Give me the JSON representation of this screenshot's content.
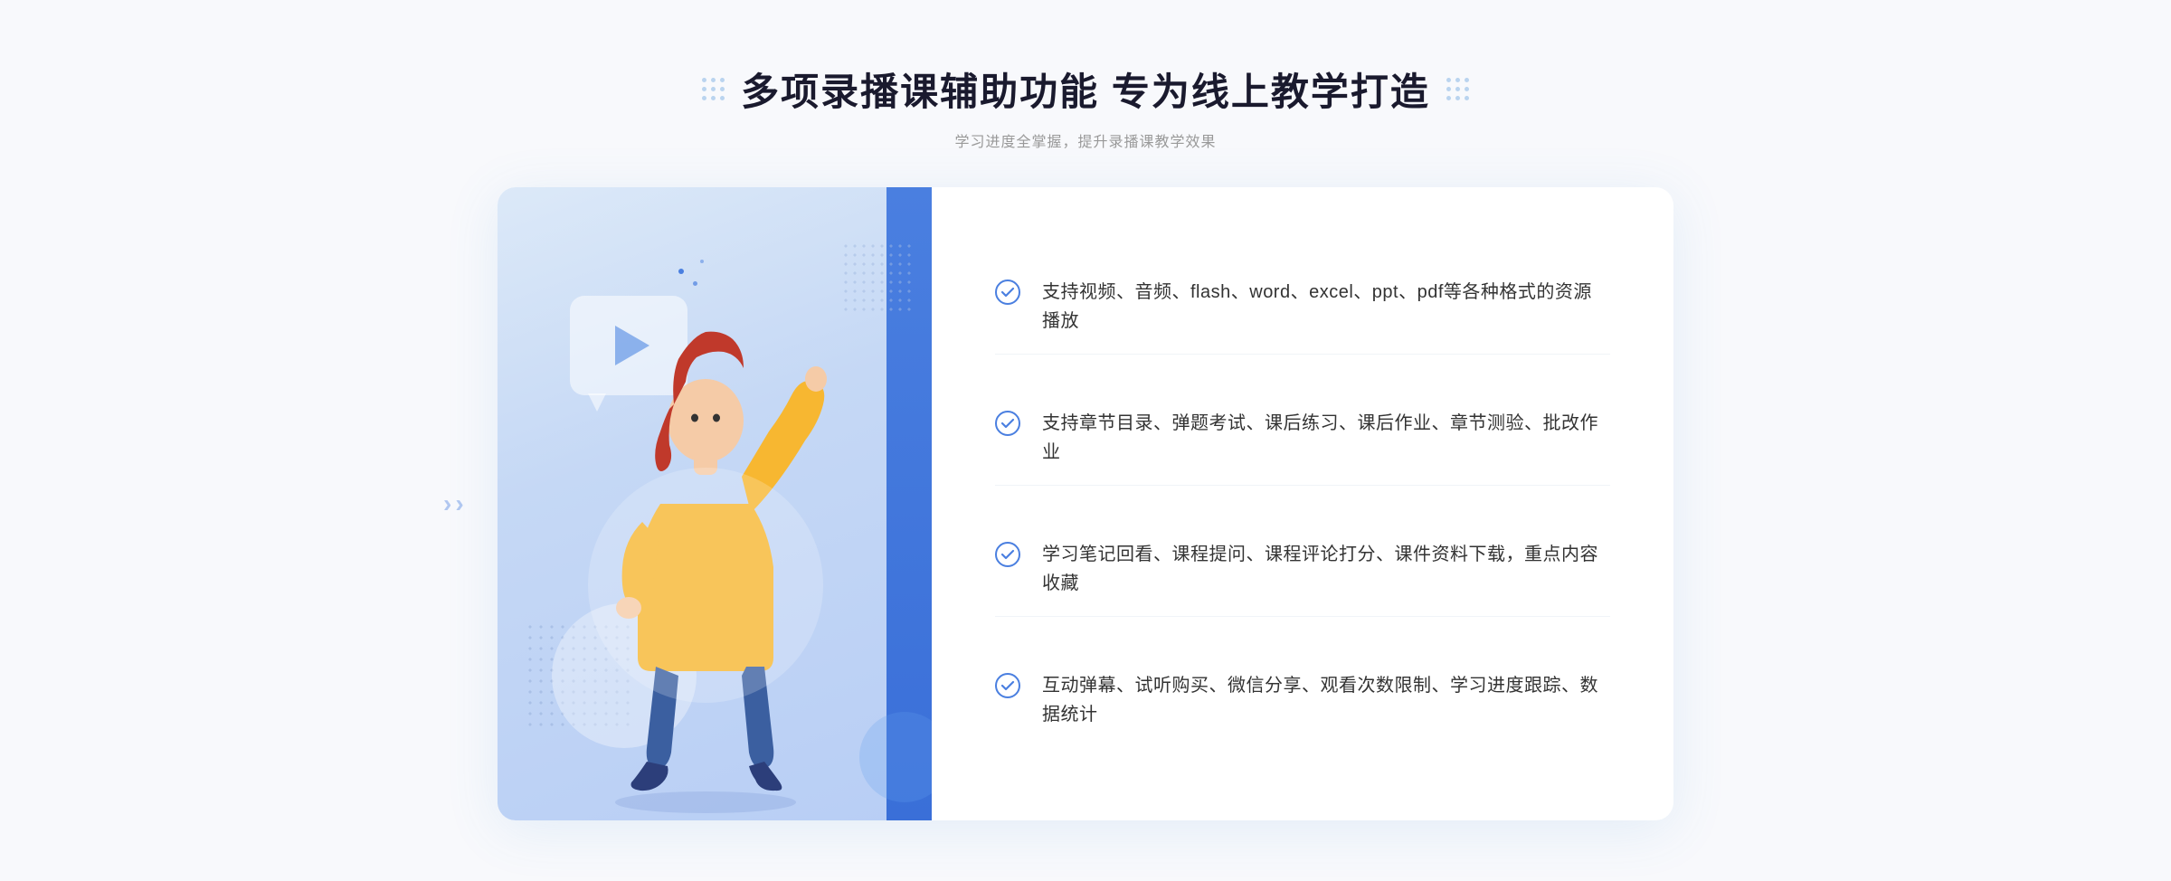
{
  "header": {
    "title": "多项录播课辅助功能 专为线上教学打造",
    "subtitle": "学习进度全掌握，提升录播课教学效果"
  },
  "decorative": {
    "left_chevron": "«",
    "dots_label": "dots-decoration"
  },
  "features": [
    {
      "id": 1,
      "text": "支持视频、音频、flash、word、excel、ppt、pdf等各种格式的资源播放"
    },
    {
      "id": 2,
      "text": "支持章节目录、弹题考试、课后练习、课后作业、章节测验、批改作业"
    },
    {
      "id": 3,
      "text": "学习笔记回看、课程提问、课程评论打分、课件资料下载，重点内容收藏"
    },
    {
      "id": 4,
      "text": "互动弹幕、试听购买、微信分享、观看次数限制、学习进度跟踪、数据统计"
    }
  ]
}
